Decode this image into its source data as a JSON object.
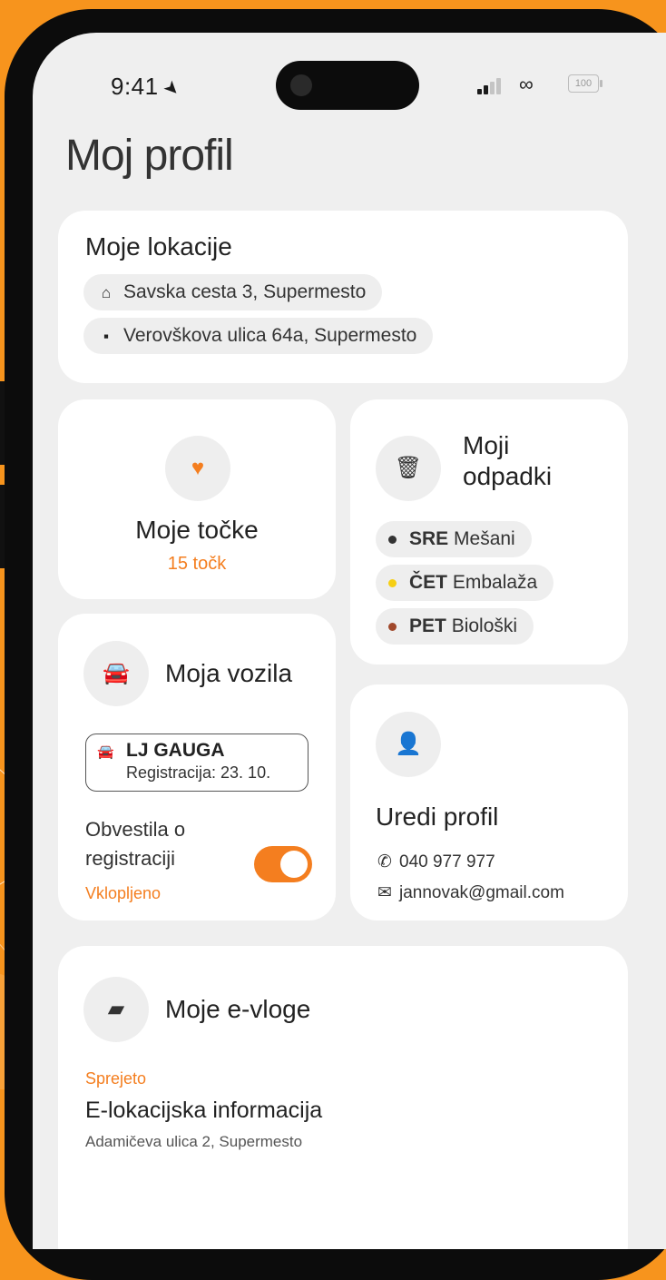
{
  "status_bar": {
    "time": "9:41",
    "battery": "100"
  },
  "page": {
    "title": "Moj profil"
  },
  "locations": {
    "title": "Moje lokacije",
    "items": [
      {
        "icon": "home-icon",
        "label": "Savska cesta 3, Supermesto"
      },
      {
        "icon": "briefcase-icon",
        "label": "Verovškova ulica 64a, Supermesto"
      }
    ]
  },
  "points": {
    "title": "Moje točke",
    "value": "15 točk"
  },
  "waste": {
    "title_line1": "Moji",
    "title_line2": "odpadki",
    "items": [
      {
        "day": "SRE",
        "type": "Mešani",
        "color": "#333333"
      },
      {
        "day": "ČET",
        "type": "Embalaža",
        "color": "#f6cf14"
      },
      {
        "day": "PET",
        "type": "Biološki",
        "color": "#a0482b"
      }
    ]
  },
  "vehicles": {
    "title": "Moja vozila",
    "vehicle": {
      "plate": "LJ GAUGA",
      "registration": "Registracija: 23. 10."
    },
    "notify_line1": "Obvestila o",
    "notify_line2": "registraciji",
    "notify_status": "Vklopljeno",
    "toggle_on": true
  },
  "profile": {
    "title": "Uredi profil",
    "phone": "040 977 977",
    "email": "jannovak@gmail.com"
  },
  "applications": {
    "title": "Moje e-vloge",
    "items": [
      {
        "status": "Sprejeto",
        "name": "E-lokacijska informacija",
        "address": "Adamičeva ulica 2, Supermesto"
      }
    ]
  },
  "colors": {
    "accent": "#f47e1f",
    "background": "#f7941d"
  }
}
